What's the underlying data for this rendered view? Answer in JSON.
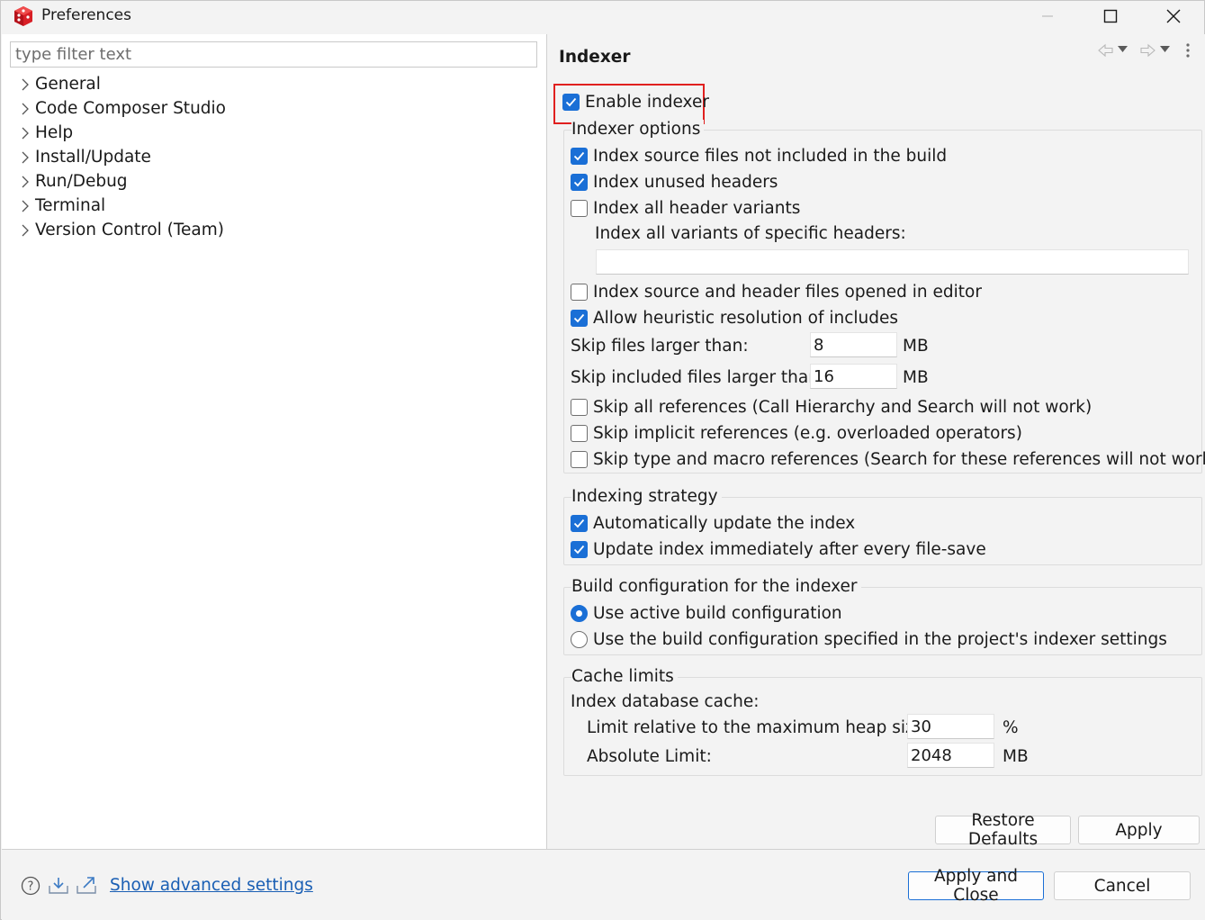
{
  "window": {
    "title": "Preferences",
    "icon": "ccs-red-cube-icon"
  },
  "left": {
    "filter_placeholder": "type filter text",
    "filter_value": "",
    "tree": [
      {
        "label": "General"
      },
      {
        "label": "Code Composer Studio"
      },
      {
        "label": "Help"
      },
      {
        "label": "Install/Update"
      },
      {
        "label": "Run/Debug"
      },
      {
        "label": "Terminal"
      },
      {
        "label": "Version Control (Team)"
      }
    ]
  },
  "page": {
    "title": "Indexer",
    "enable_indexer": {
      "label": "Enable indexer",
      "checked": true
    },
    "indexer_options": {
      "title": "Indexer options",
      "source_not_in_build": {
        "label": "Index source files not included in the build",
        "checked": true
      },
      "unused_headers": {
        "label": "Index unused headers",
        "checked": true
      },
      "all_header_variants": {
        "label": "Index all header variants",
        "checked": false
      },
      "specific_headers_label": "Index all variants of specific headers:",
      "specific_headers_value": "",
      "opened_in_editor": {
        "label": "Index source and header files opened in editor",
        "checked": false
      },
      "heuristic_includes": {
        "label": "Allow heuristic resolution of includes",
        "checked": true
      },
      "skip_larger": {
        "label": "Skip files larger than:",
        "value": "8",
        "unit": "MB"
      },
      "skip_included_larger": {
        "label": "Skip included files larger than:",
        "value": "16",
        "unit": "MB"
      },
      "skip_all_refs": {
        "label": "Skip all references (Call Hierarchy and Search will not work)",
        "checked": false
      },
      "skip_implicit_refs": {
        "label": "Skip implicit references (e.g. overloaded operators)",
        "checked": false
      },
      "skip_type_macro_refs": {
        "label": "Skip type and macro references (Search for these references will not work)",
        "checked": false
      }
    },
    "indexing_strategy": {
      "title": "Indexing strategy",
      "auto_update": {
        "label": "Automatically update the index",
        "checked": true
      },
      "update_on_save": {
        "label": "Update index immediately after every file-save",
        "checked": true
      }
    },
    "build_config": {
      "title": "Build configuration for the indexer",
      "use_active": {
        "label": "Use active build configuration",
        "selected": true
      },
      "use_project": {
        "label": "Use the build configuration specified in the project's indexer settings",
        "selected": false
      }
    },
    "cache_limits": {
      "title": "Cache limits",
      "db_cache_label": "Index database cache:",
      "relative_limit": {
        "label": "Limit relative to the maximum heap size:",
        "value": "30",
        "unit": "%"
      },
      "absolute_limit": {
        "label": "Absolute Limit:",
        "value": "2048",
        "unit": "MB"
      }
    },
    "buttons": {
      "restore_defaults": "Restore Defaults",
      "apply": "Apply"
    }
  },
  "footer": {
    "advanced_link": "Show advanced settings",
    "apply_close": "Apply and Close",
    "cancel": "Cancel"
  },
  "colors": {
    "accent": "#1a6fd6",
    "highlight_border": "#e0201f",
    "link": "#1a5fb4",
    "background": "#f3f3f3"
  }
}
